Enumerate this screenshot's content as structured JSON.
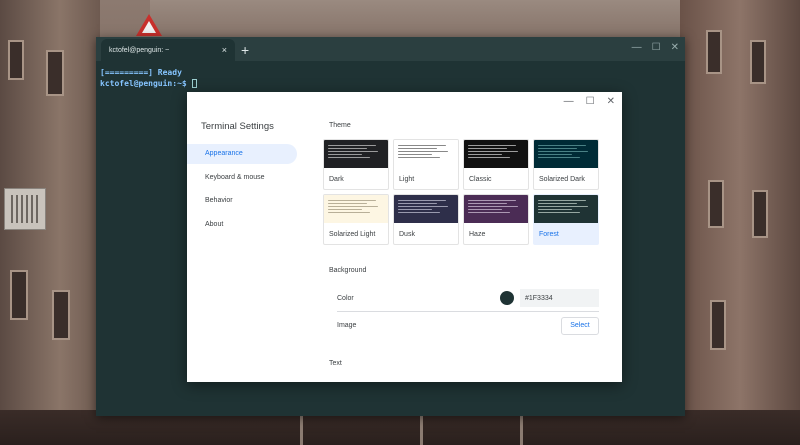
{
  "terminal": {
    "tab_title": "kctofel@penguin: ~",
    "tab_close": "×",
    "new_tab": "+",
    "controls": {
      "minimize": "—",
      "maximize": "☐",
      "close": "✕"
    },
    "lines": [
      {
        "text": "[=========] Ready"
      },
      {
        "prompt": "kctofel@penguin:~$ "
      }
    ]
  },
  "settings": {
    "title": "Terminal Settings",
    "controls": {
      "minimize": "—",
      "maximize": "☐",
      "close": "✕"
    },
    "nav": [
      {
        "label": "Appearance",
        "active": true
      },
      {
        "label": "Keyboard & mouse",
        "active": false
      },
      {
        "label": "Behavior",
        "active": false
      },
      {
        "label": "About",
        "active": false
      }
    ],
    "theme_section": "Theme",
    "themes": [
      {
        "name": "Dark",
        "bg": "#202124",
        "fg": "#d0d0d0",
        "selected": false
      },
      {
        "name": "Light",
        "bg": "#ffffff",
        "fg": "#555555",
        "selected": false
      },
      {
        "name": "Classic",
        "bg": "#111111",
        "fg": "#d8d8d8",
        "selected": false
      },
      {
        "name": "Solarized Dark",
        "bg": "#002b36",
        "fg": "#6aa6a6",
        "selected": false
      },
      {
        "name": "Solarized Light",
        "bg": "#fdf6e3",
        "fg": "#9a9178",
        "selected": false
      },
      {
        "name": "Dusk",
        "bg": "#2e2f4a",
        "fg": "#c8c8d8",
        "selected": false
      },
      {
        "name": "Haze",
        "bg": "#4b2c55",
        "fg": "#d6c6dc",
        "selected": false
      },
      {
        "name": "Forest",
        "bg": "#1f3334",
        "fg": "#c9d9d0",
        "selected": true
      }
    ],
    "background_section": "Background",
    "color_label": "Color",
    "color_value": "#1F3334",
    "image_label": "Image",
    "select_label": "Select",
    "text_section": "Text"
  }
}
